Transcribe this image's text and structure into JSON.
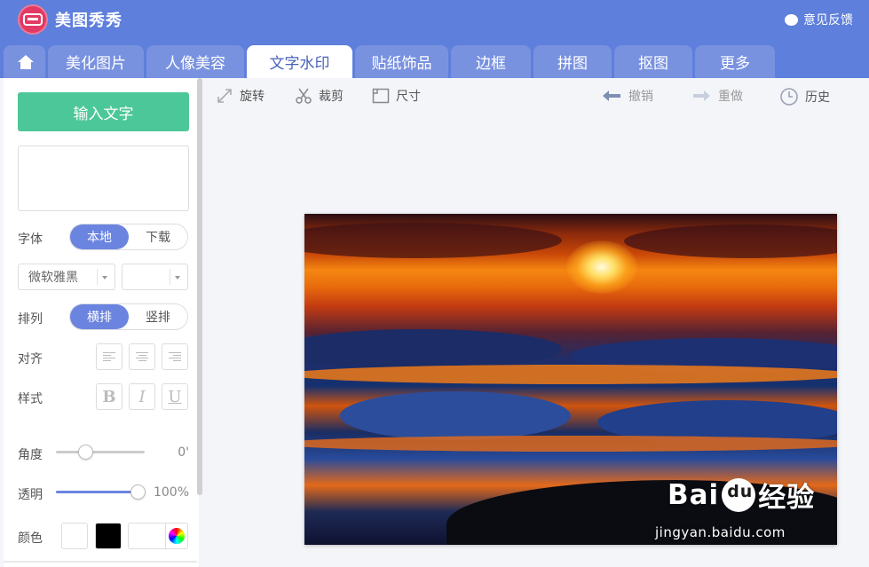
{
  "app": {
    "brand": "美图秀秀",
    "feedback": "意见反馈"
  },
  "tabs": [
    {
      "label": "美化图片"
    },
    {
      "label": "人像美容"
    },
    {
      "label": "文字水印",
      "active": true
    },
    {
      "label": "贴纸饰品"
    },
    {
      "label": "边框"
    },
    {
      "label": "拼图"
    },
    {
      "label": "抠图"
    },
    {
      "label": "更多"
    }
  ],
  "panel": {
    "input_button": "输入文字",
    "text_value": "",
    "font": {
      "label": "字体",
      "local": "本地",
      "download": "下载",
      "selected": "微软雅黑",
      "size": ""
    },
    "arrange": {
      "label": "排列",
      "horizontal": "横排",
      "vertical": "竖排"
    },
    "align": {
      "label": "对齐"
    },
    "style": {
      "label": "样式",
      "bold": "B",
      "italic": "I",
      "underline": "U"
    },
    "angle": {
      "label": "角度",
      "value": "0'",
      "level": 0.33
    },
    "opacity": {
      "label": "透明",
      "value": "100%",
      "level": 1.0
    },
    "color": {
      "label": "颜色",
      "swatches": [
        "#ffffff",
        "#000000"
      ]
    }
  },
  "toolbar": {
    "rotate": "旋转",
    "crop": "裁剪",
    "size": "尺寸",
    "undo": "撤销",
    "redo": "重做",
    "history": "历史"
  },
  "watermark": {
    "brand": "Bai",
    "brand_suffix": "经验",
    "url": "jingyan.baidu.com"
  },
  "colors": {
    "header": "#5e7fdb",
    "accent": "#6a84e0",
    "primary_button": "#4cc799"
  }
}
